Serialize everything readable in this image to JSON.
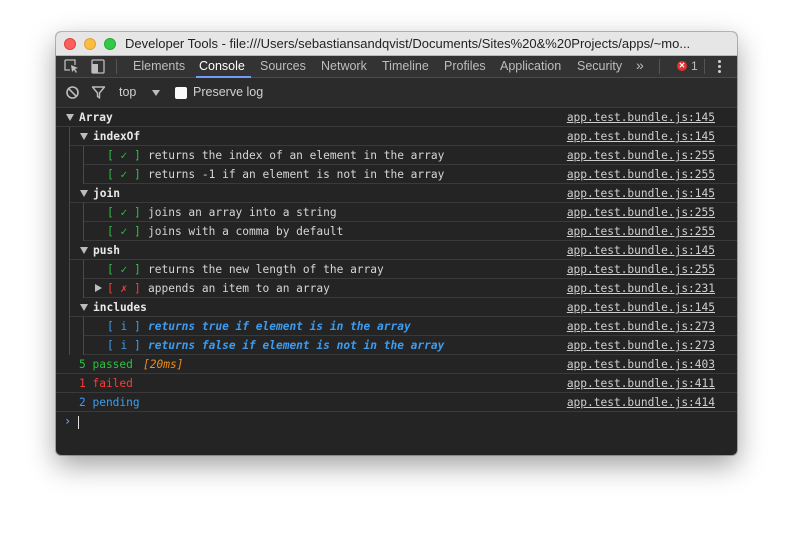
{
  "window": {
    "title": "Developer Tools - file:///Users/sebastiansandqvist/Documents/Sites%20&%20Projects/apps/~mo..."
  },
  "tabs": [
    {
      "label": "Elements",
      "active": false
    },
    {
      "label": "Console",
      "active": true
    },
    {
      "label": "Sources",
      "active": false
    },
    {
      "label": "Network",
      "active": false
    },
    {
      "label": "Timeline",
      "active": false
    },
    {
      "label": "Profiles",
      "active": false
    },
    {
      "label": "Application",
      "active": false
    },
    {
      "label": "Security",
      "active": false
    }
  ],
  "toolbar": {
    "more_tabs": "»",
    "error_count": "1",
    "error_glyph": "✕"
  },
  "filter": {
    "context": "top",
    "preserve_log_label": "Preserve log",
    "preserve_log_checked": false
  },
  "colors": {
    "pass": "#29c23f",
    "fail": "#ff3b30",
    "pending": "#3d9cf0",
    "duration": "#f08c1a",
    "accent": "#6e9ef5"
  },
  "console": {
    "groups": {
      "array": {
        "label": "Array",
        "source": "app.test.bundle.js:145"
      },
      "indexof": {
        "label": "indexOf",
        "source": "app.test.bundle.js:145"
      },
      "join": {
        "label": "join",
        "source": "app.test.bundle.js:145"
      },
      "push": {
        "label": "push",
        "source": "app.test.bundle.js:145"
      },
      "includes": {
        "label": "includes",
        "source": "app.test.bundle.js:145"
      }
    },
    "tests": [
      {
        "status": "[ ✓ ]",
        "text": "returns the index of an element in the array",
        "source": "app.test.bundle.js:255"
      },
      {
        "status": "[ ✓ ]",
        "text": "returns -1 if an element is not in the array",
        "source": "app.test.bundle.js:255"
      },
      {
        "status": "[ ✓ ]",
        "text": "joins an array into a string",
        "source": "app.test.bundle.js:255"
      },
      {
        "status": "[ ✓ ]",
        "text": "joins with a comma by default",
        "source": "app.test.bundle.js:255"
      },
      {
        "status": "[ ✓ ]",
        "text": "returns the new length of the array",
        "source": "app.test.bundle.js:255"
      },
      {
        "status": "[ ✗ ]",
        "text": "appends an item to an array",
        "source": "app.test.bundle.js:231"
      },
      {
        "status": "[ i ]",
        "text": "returns true if element is in the array",
        "source": "app.test.bundle.js:273"
      },
      {
        "status": "[ i ]",
        "text": "returns false if element is not in the array",
        "source": "app.test.bundle.js:273"
      }
    ],
    "summary": {
      "passed": {
        "text": "5 passed",
        "duration": "[20ms]",
        "source": "app.test.bundle.js:403"
      },
      "failed": {
        "text": "1 failed",
        "source": "app.test.bundle.js:411"
      },
      "pending": {
        "text": "2 pending",
        "source": "app.test.bundle.js:414"
      }
    },
    "prompt": "›"
  }
}
